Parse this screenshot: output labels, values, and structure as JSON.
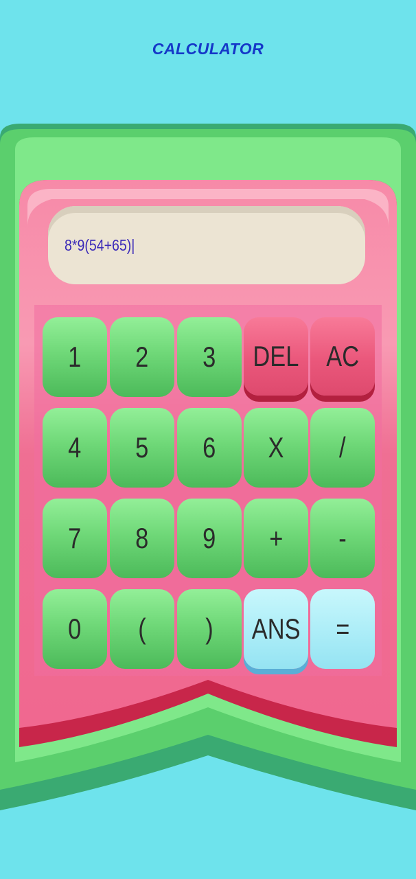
{
  "app": {
    "title": "CALCULATOR"
  },
  "display": {
    "expression": "8*9(54+65)|"
  },
  "keys": {
    "k1": "1",
    "k2": "2",
    "k3": "3",
    "del": "DEL",
    "ac": "AC",
    "k4": "4",
    "k5": "5",
    "k6": "6",
    "mul": "X",
    "div": "/",
    "k7": "7",
    "k8": "8",
    "k9": "9",
    "add": "+",
    "sub": "-",
    "k0": "0",
    "lparen": "(",
    "rparen": ")",
    "ans": "ANS",
    "eq": "="
  },
  "colors": {
    "background": "#6ee3ec",
    "title": "#1538c8",
    "body_green": "#7ee88a",
    "body_pink": "#f2819f",
    "key_green": "#6fd878",
    "key_red": "#ea577b",
    "key_blue": "#a9ecf7",
    "display_bg": "#ece4d3",
    "display_text": "#3b2ab8"
  }
}
